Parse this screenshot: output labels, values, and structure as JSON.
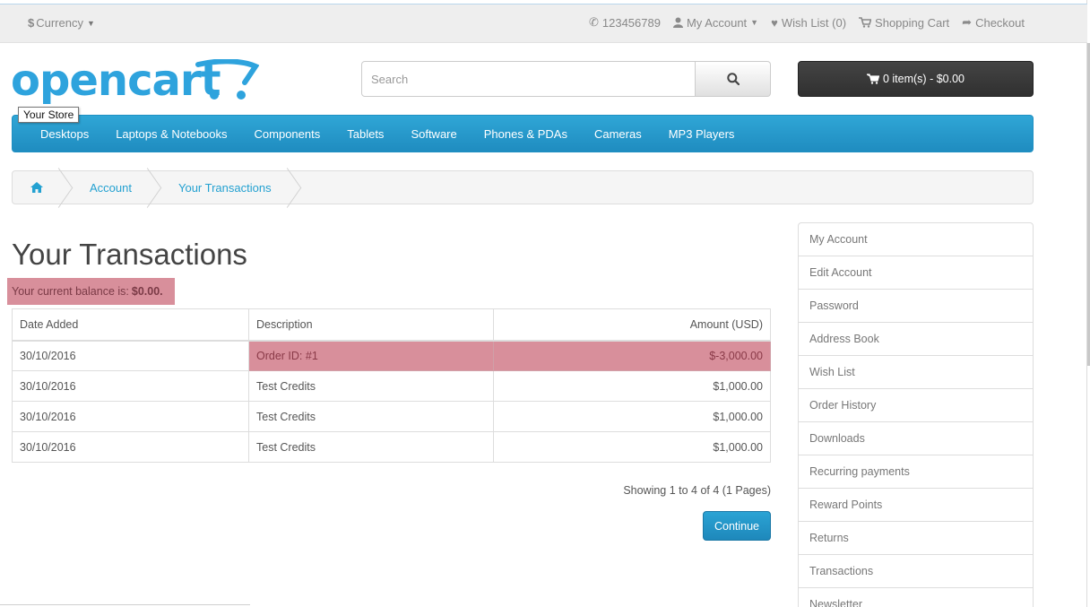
{
  "topbar": {
    "currency_label": "Currency",
    "currency_symbol": "$",
    "phone": "123456789",
    "my_account": "My Account",
    "wishlist": "Wish List (0)",
    "shopping_cart": "Shopping Cart",
    "checkout": "Checkout"
  },
  "header": {
    "logo_text": "opencart",
    "tooltip": "Your Store",
    "search_placeholder": "Search",
    "cart_label": "0 item(s) - $0.00"
  },
  "menu": {
    "items": [
      "Desktops",
      "Laptops & Notebooks",
      "Components",
      "Tablets",
      "Software",
      "Phones & PDAs",
      "Cameras",
      "MP3 Players"
    ]
  },
  "breadcrumb": {
    "items": [
      "Account",
      "Your Transactions"
    ]
  },
  "main": {
    "title": "Your Transactions",
    "balance_text": "Your current balance is:",
    "balance_value": "$0.00.",
    "table": {
      "headers": [
        "Date Added",
        "Description",
        "Amount (USD)"
      ],
      "rows": [
        {
          "date": "30/10/2016",
          "description": "Order ID: #1",
          "amount": "$-3,000.00"
        },
        {
          "date": "30/10/2016",
          "description": "Test Credits",
          "amount": "$1,000.00"
        },
        {
          "date": "30/10/2016",
          "description": "Test Credits",
          "amount": "$1,000.00"
        },
        {
          "date": "30/10/2016",
          "description": "Test Credits",
          "amount": "$1,000.00"
        }
      ]
    },
    "showing": "Showing 1 to 4 of 4 (1 Pages)",
    "continue_label": "Continue"
  },
  "sidebar": {
    "items": [
      "My Account",
      "Edit Account",
      "Password",
      "Address Book",
      "Wish List",
      "Order History",
      "Downloads",
      "Recurring payments",
      "Reward Points",
      "Returns",
      "Transactions",
      "Newsletter"
    ]
  },
  "colors": {
    "accent": "#23a1d1",
    "menu": "#229ac8",
    "highlight": "#d88f9b",
    "cart_button": "#363636"
  }
}
